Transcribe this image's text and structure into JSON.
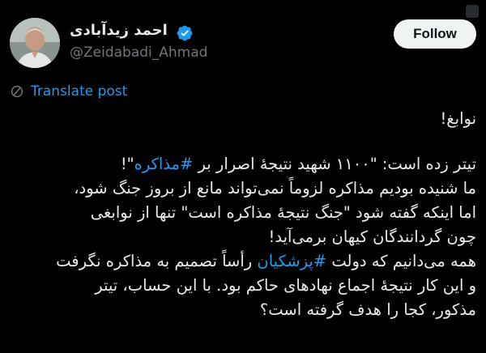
{
  "header": {
    "display_name": "احمد زیدآبادی",
    "handle": "@Zeidabadi_Ahmad",
    "follow_label": "Follow",
    "verified_icon": "verified-badge-icon",
    "accent_color": "#1d9bf0"
  },
  "translate_label": "Translate post",
  "tweet": {
    "line1": "نوابغ!",
    "line2_pre": "تیتر زده است: \"۱۱۰۰ شهید نتیجهٔ اصرار بر ",
    "line2_tag": "#مذاکره",
    "line2_post": "\"!",
    "line3": "ما شنیده بودیم مذاکره لزوماً نمی‌تواند مانع از بروز جنگ شود،",
    "line4": "اما اینکه گفته شود \"جنگ نتیجهٔ مذاکره است\" تنها از نوابغی",
    "line5": "چون گردانندگان کیهان برمی‌آید!",
    "line6_pre": "همه می‌دانیم که دولت ",
    "line6_tag": "#پزشکیان",
    "line6_post": " رأساً تصمیم به مذاکره نگرفت",
    "line7": "و  این کار نتیجهٔ اجماع نهادهای حاکم بود. با این حساب، تیتر",
    "line8": "مذکور، کجا را هدف گرفته است؟"
  }
}
